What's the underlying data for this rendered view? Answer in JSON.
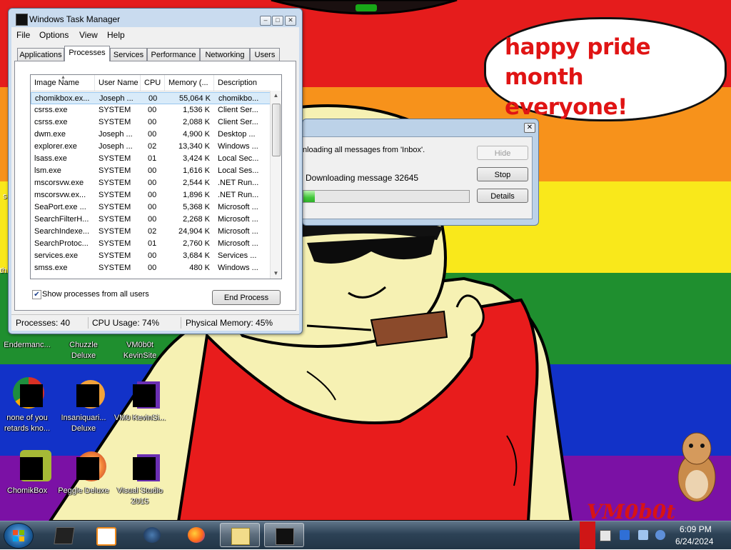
{
  "speech_bubble": {
    "line1": "happy pride month",
    "line2": "everyone!"
  },
  "signature": "VM0b0t",
  "desktop_icons": [
    {
      "label": "Endermanc...",
      "icon": "enderman-icon"
    },
    {
      "label": "Chuzzle Deluxe",
      "icon": "chuzzle-icon"
    },
    {
      "label": "VM0b0t KevinSite",
      "icon": "vm0b0t-icon"
    },
    {
      "label": "none of you retards kno...",
      "icon": "chrome-icon"
    },
    {
      "label": "Insaniquari... Deluxe",
      "icon": "insaniquarium-icon"
    },
    {
      "label": "VM0 KevinSi...",
      "icon": "visual-studio-icon"
    },
    {
      "label": "ChomikBox",
      "icon": "chomikbox-icon"
    },
    {
      "label": "Peggle Deluxe",
      "icon": "peggle-icon"
    },
    {
      "label": "Visual Studio 2015",
      "icon": "visual-studio-icon"
    }
  ],
  "edge_labels": {
    "left1": "s",
    "left2": "th"
  },
  "download_dialog": {
    "message": "nloading all messages from 'Inbox'.",
    "status": "Downloading message 32645",
    "progress": 0.07,
    "buttons": {
      "hide": "Hide",
      "stop": "Stop",
      "details": "Details"
    },
    "close_glyph": "✕"
  },
  "task_manager": {
    "title": "Windows Task Manager",
    "menu": [
      "File",
      "Options",
      "View",
      "Help"
    ],
    "tabs": [
      "Applications",
      "Processes",
      "Services",
      "Performance",
      "Networking",
      "Users"
    ],
    "active_tab": "Processes",
    "columns": [
      "Image Name",
      "User Name",
      "CPU",
      "Memory (...",
      "Description"
    ],
    "rows": [
      [
        "chomikbox.ex...",
        "Joseph ...",
        "00",
        "55,064 K",
        "chomikbo..."
      ],
      [
        "csrss.exe",
        "SYSTEM",
        "00",
        "1,536 K",
        "Client Ser..."
      ],
      [
        "csrss.exe",
        "SYSTEM",
        "00",
        "2,088 K",
        "Client Ser..."
      ],
      [
        "dwm.exe",
        "Joseph ...",
        "00",
        "4,900 K",
        "Desktop ..."
      ],
      [
        "explorer.exe",
        "Joseph ...",
        "02",
        "13,340 K",
        "Windows ..."
      ],
      [
        "lsass.exe",
        "SYSTEM",
        "01",
        "3,424 K",
        "Local Sec..."
      ],
      [
        "lsm.exe",
        "SYSTEM",
        "00",
        "1,616 K",
        "Local Ses..."
      ],
      [
        "mscorsvw.exe",
        "SYSTEM",
        "00",
        "2,544 K",
        ".NET Run..."
      ],
      [
        "mscorsvw.ex...",
        "SYSTEM",
        "00",
        "1,896 K",
        ".NET Run..."
      ],
      [
        "SeaPort.exe ...",
        "SYSTEM",
        "00",
        "5,368 K",
        "Microsoft ..."
      ],
      [
        "SearchFilterH...",
        "SYSTEM",
        "00",
        "2,268 K",
        "Microsoft ..."
      ],
      [
        "SearchIndexe...",
        "SYSTEM",
        "02",
        "24,904 K",
        "Microsoft ..."
      ],
      [
        "SearchProtoc...",
        "SYSTEM",
        "01",
        "2,760 K",
        "Microsoft ..."
      ],
      [
        "services.exe",
        "SYSTEM",
        "00",
        "3,684 K",
        "Services ..."
      ],
      [
        "smss.exe",
        "SYSTEM",
        "00",
        "480 K",
        "Windows ..."
      ]
    ],
    "show_all_users": {
      "label": "Show processes from all users",
      "checked": true
    },
    "end_process": "End Process",
    "status": {
      "processes": "Processes: 40",
      "cpu": "CPU Usage: 74%",
      "memory": "Physical Memory: 45%"
    }
  },
  "taskbar": {
    "apps": [
      "media-center-icon",
      "media-player-icon",
      "steam-icon",
      "firefox-icon",
      "explorer-window-icon",
      "task-manager-icon"
    ],
    "clock": {
      "time": "6:09 PM",
      "date": "6/24/2024"
    }
  }
}
